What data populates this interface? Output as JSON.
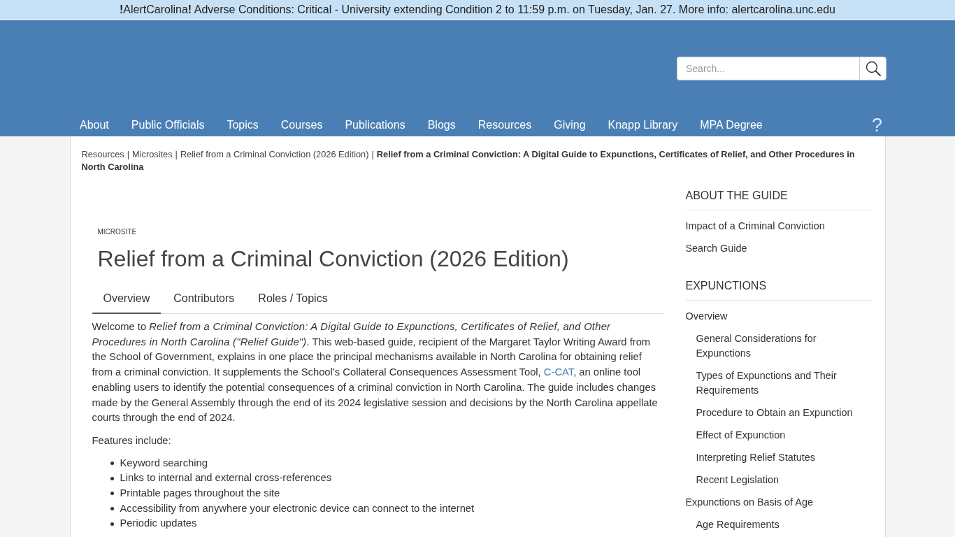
{
  "alert_bar": {
    "message": "**!**AlertCarolina**!** Adverse Conditions: Critical - University extending Condition 2 to 11:59 p.m. on Tuesday, Jan. 27. More info: alertcarolina.unc.edu"
  },
  "header": {
    "search": {
      "placeholder": "Search..."
    },
    "nav": [
      {
        "label": "About"
      },
      {
        "label": "Public Officials"
      },
      {
        "label": "Topics"
      },
      {
        "label": "Courses"
      },
      {
        "label": "Publications"
      },
      {
        "label": "Blogs"
      },
      {
        "label": "Resources"
      },
      {
        "label": "Giving"
      },
      {
        "label": "Knapp Library"
      },
      {
        "label": "MPA Degree"
      }
    ],
    "help": "?"
  },
  "breadcrumb": [
    {
      "label": "Resources",
      "current": false,
      "separator": "|"
    },
    {
      "label": "Microsites",
      "current": false,
      "separator": "|"
    },
    {
      "label": "Relief from a Criminal Conviction (2026 Edition)",
      "current": false,
      "separator": "|"
    },
    {
      "label": "Relief from a Criminal Conviction: A Digital Guide to Expunctions, Certificates of Relief, and Other Procedures in North Carolina",
      "current": true
    }
  ],
  "main": {
    "eyebrow": "MICROSITE",
    "title": "Relief from a Criminal Conviction (2026 Edition)",
    "tabs": [
      {
        "label": "Overview",
        "selected": true
      },
      {
        "label": "Contributors",
        "selected": false
      },
      {
        "label": "Roles / Topics",
        "selected": false
      }
    ],
    "intro": {
      "text_before": "Welcome to *Relief from a Criminal Conviction: A Digital Guide to Expunctions, Certificates of Relief, and Other Procedures in North Carolina (\"Relief Guide\")*. This web-based guide, recipient of the Margaret Taylor Writing Award from the School of Government, explains in one place the principal mechanisms available in North Carolina for obtaining relief from a criminal conviction. It supplements the School’s Collateral Consequences Assessment Tool, ",
      "link": "C-CAT",
      "text_after": ", an online tool enabling users to identify the potential consequences of a criminal conviction in North Carolina. The guide includes changes made by the General Assembly through the end of its 2024 legislative session and decisions by the North Carolina appellate courts through the end of 2024."
    },
    "features_heading": "Features include:",
    "features": [
      "Keyword searching",
      "Links to internal and external cross-references",
      "Printable pages throughout the site",
      "Accessibility from anywhere your electronic device can connect to the internet",
      "Periodic updates"
    ]
  },
  "sidebar": {
    "sections": [
      {
        "heading": "ABOUT THE GUIDE",
        "items": [
          {
            "label": "Impact of a Criminal Conviction"
          },
          {
            "label": "Search Guide"
          }
        ]
      },
      {
        "heading": "EXPUNCTIONS",
        "items": [
          {
            "label": "Overview",
            "children": [
              {
                "label": "General Considerations for Expunctions"
              },
              {
                "label": "Types of Expunctions and Their Requirements"
              },
              {
                "label": "Procedure to Obtain an Expunction"
              },
              {
                "label": "Effect of Expunction"
              },
              {
                "label": "Interpreting Relief Statutes"
              },
              {
                "label": "Recent Legislation"
              }
            ]
          },
          {
            "label": "Expunctions on Basis of Age",
            "children": [
              {
                "label": "Age Requirements"
              }
            ]
          }
        ]
      }
    ]
  }
}
